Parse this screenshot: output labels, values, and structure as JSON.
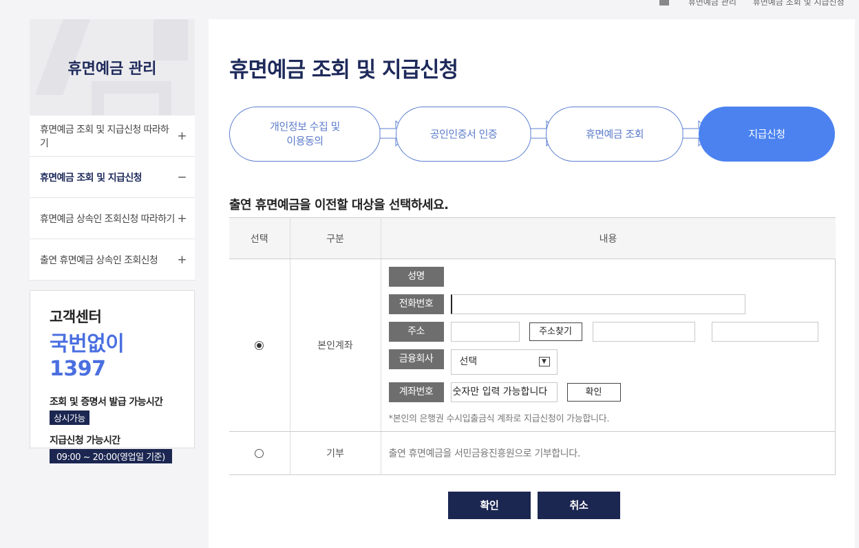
{
  "breadcrumb": [
    "휴면예금 관리",
    "휴면예금 조회 및 지급신청"
  ],
  "sidebar": {
    "title": "휴면예금 관리",
    "items": [
      {
        "label": "휴면예금 조회 및 지급신청 따라하기",
        "sign": "+",
        "active": false
      },
      {
        "label": "휴면예금 조회 및 지급신청",
        "sign": "−",
        "active": true
      },
      {
        "label": "휴면예금 상속인 조회신청 따라하기",
        "sign": "+",
        "active": false
      },
      {
        "label": "출연 휴면예금 상속인 조회신청",
        "sign": "+",
        "active": false
      }
    ]
  },
  "customer_center": {
    "title": "고객센터",
    "phone": "국번없이 1397",
    "hours1_label": "조회 및 증명서 발급 가능시간",
    "hours1_value": "상시가능",
    "hours2_label": "지급신청 가능시간",
    "hours2_value": "09:00 ~ 20:00(영업일 기준)"
  },
  "page_title": "휴면예금 조회 및 지급신청",
  "steps": [
    {
      "label": "개인정보 수집 및\n이용동의",
      "active": false
    },
    {
      "label": "공인인증서 인증",
      "active": false
    },
    {
      "label": "휴면예금 조회",
      "active": false
    },
    {
      "label": "지급신청",
      "active": true
    }
  ],
  "section_title": "출연 휴면예금을 이전할 대상을 선택하세요.",
  "table": {
    "headers": [
      "선택",
      "구분",
      "내용"
    ],
    "row1": {
      "category": "본인계좌",
      "selected": true,
      "fields": {
        "name_label": "성명",
        "name_value": "",
        "phone_label": "전화번호",
        "phone_value": "",
        "address_label": "주소",
        "address_search": "주소찾기",
        "bank_label": "금융회사",
        "bank_selected": "선택",
        "account_label": "계좌번호",
        "account_placeholder": "숫자만 입력 가능합니다",
        "account_confirm": "확인"
      },
      "note": "*본인의 은행권 수시입출금식 계좌로 지급신청이 가능합니다."
    },
    "row2": {
      "category": "기부",
      "selected": false,
      "text": "출연 휴면예금을 서민금융진흥원으로 기부합니다."
    }
  },
  "buttons": {
    "confirm": "확인",
    "cancel": "취소"
  },
  "colors": {
    "navy": "#1b2651",
    "accent_blue": "#4b82f0",
    "step_outline": "#5b7fd0"
  }
}
